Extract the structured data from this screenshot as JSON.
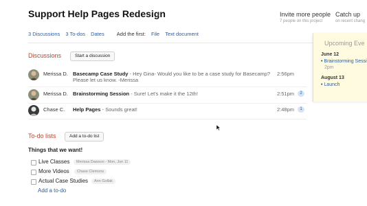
{
  "header": {
    "title": "Support Help Pages Redesign",
    "invite": {
      "label": "Invite more people",
      "sub": "7 people on this project"
    },
    "catchup": {
      "label": "Catch up",
      "sub": "on recent chang"
    }
  },
  "subnav": {
    "discussions": "3 Discussions",
    "todos": "3 To-dos",
    "dates": "Dates",
    "add_first": "Add the first:",
    "file": "File",
    "text_doc": "Text document"
  },
  "upcoming": {
    "title": "Upcoming Eve",
    "events": [
      {
        "date": "June 12",
        "name": "Brainstorming Sessi",
        "time": "2pm"
      },
      {
        "date": "August 13",
        "name": "Launch"
      }
    ]
  },
  "discussions": {
    "title": "Discussions",
    "start_button": "Start a discussion",
    "rows": [
      {
        "author": "Merissa D.",
        "subject": "Basecamp Case Study",
        "preview": " - Hey Gina- Would you like to be a case study for Basecamp? Please let us know. -Merissa",
        "time": "2:56pm",
        "count": ""
      },
      {
        "author": "Merissa D.",
        "subject": "Brainstorming Session",
        "preview": " - Sure! Let's make it the 12th!",
        "time": "2:51pm",
        "count": "2"
      },
      {
        "author": "Chase C.",
        "subject": "Help Pages",
        "preview": " - Sounds great!",
        "time": "2:48pm",
        "count": "1"
      }
    ]
  },
  "todos": {
    "title": "To-do lists",
    "add_button": "Add a to-do list",
    "list_title": "Things that we want!",
    "items": [
      {
        "label": "Live Classes",
        "tag": "Merissa Dawson - Mon, Jun 11"
      },
      {
        "label": "More Videos",
        "tag": "Chase Clemons"
      },
      {
        "label": "Actual Case Studies",
        "tag": "Ann Gollak"
      }
    ],
    "add_link": "Add a to-do"
  },
  "colors": {
    "accent": "#2a5d9f",
    "section_red": "#b8442f",
    "note_yellow": "#fffbe0"
  }
}
